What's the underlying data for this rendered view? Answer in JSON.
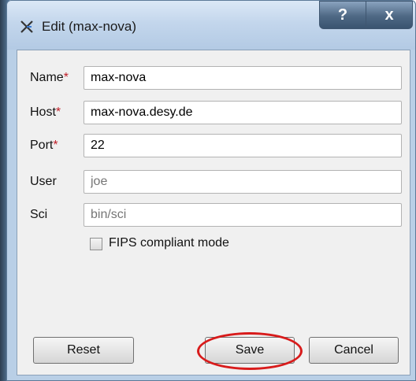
{
  "window": {
    "title": "Edit (max-nova)",
    "help_label": "?",
    "close_label": "x"
  },
  "form": {
    "name_label": "Name",
    "host_label": "Host",
    "port_label": "Port",
    "user_label": "User",
    "sci_label": "Sci",
    "required_marker": "*",
    "name_value": "max-nova",
    "host_value": "max-nova.desy.de",
    "port_value": "22",
    "user_placeholder": "joe",
    "sci_placeholder": "bin/sci",
    "fips_label": "FIPS compliant mode",
    "fips_checked": false
  },
  "buttons": {
    "reset": "Reset",
    "save": "Save",
    "cancel": "Cancel"
  },
  "colors": {
    "required": "#c0202a",
    "annotation": "#d81b1b"
  }
}
